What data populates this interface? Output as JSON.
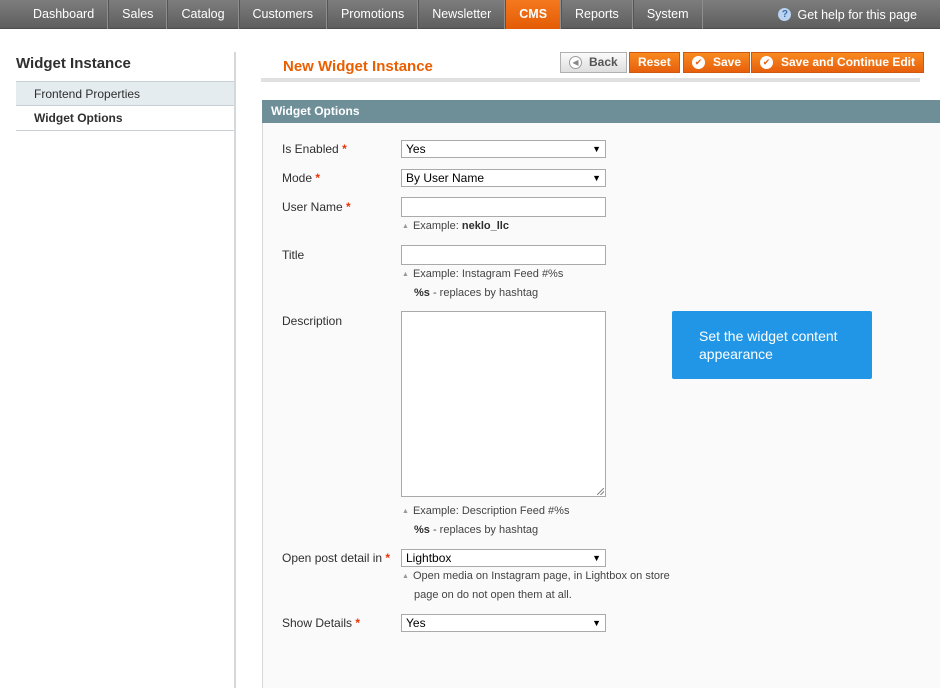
{
  "nav": {
    "items": [
      {
        "label": "Dashboard"
      },
      {
        "label": "Sales"
      },
      {
        "label": "Catalog"
      },
      {
        "label": "Customers"
      },
      {
        "label": "Promotions"
      },
      {
        "label": "Newsletter"
      },
      {
        "label": "CMS",
        "active": true
      },
      {
        "label": "Reports"
      },
      {
        "label": "System"
      }
    ],
    "help": "Get help for this page",
    "active_color": "#eb5e00"
  },
  "sidebar": {
    "title": "Widget Instance",
    "tabs": [
      {
        "label": "Frontend Properties",
        "active": false
      },
      {
        "label": "Widget Options",
        "active": true
      }
    ]
  },
  "header": {
    "title": "New Widget Instance",
    "buttons": {
      "back": "Back",
      "reset": "Reset",
      "save": "Save",
      "save_continue": "Save and Continue Edit"
    }
  },
  "fieldset": {
    "title": "Widget Options",
    "fields": {
      "is_enabled": {
        "label": "Is Enabled",
        "required": "*",
        "value": "Yes"
      },
      "mode": {
        "label": "Mode",
        "required": "*",
        "value": "By User Name"
      },
      "user_name": {
        "label": "User Name",
        "required": "*",
        "value": "",
        "note_prefix": "Example: ",
        "note_bold": "neklo_llc"
      },
      "title": {
        "label": "Title",
        "value": "",
        "note": "Example: Instagram Feed #%s",
        "note2_bold": "%s",
        "note2": " - replaces by hashtag"
      },
      "description": {
        "label": "Description",
        "value": "",
        "note": "Example: Description Feed #%s",
        "note2_bold": "%s",
        "note2": " - replaces by hashtag"
      },
      "open_post": {
        "label": "Open post detail in",
        "required": "*",
        "value": "Lightbox",
        "note_line1": "Open media on Instagram page, in Lightbox on store",
        "note_line2": "page on do not open them at all."
      },
      "show_details": {
        "label": "Show Details",
        "required": "*",
        "value": "Yes"
      }
    }
  },
  "tooltip": {
    "text": "Set the widget content appearance",
    "color": "#2196e6"
  }
}
